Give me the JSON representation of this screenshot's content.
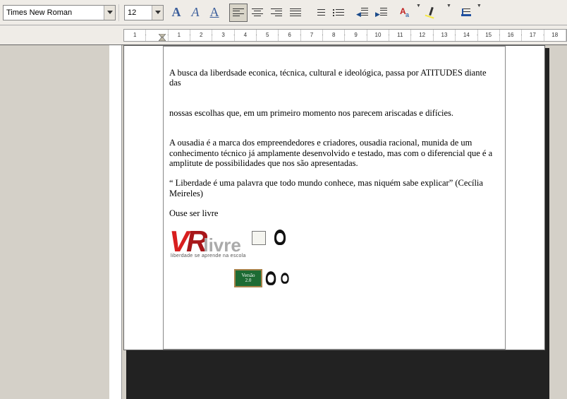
{
  "toolbar": {
    "font_name": "Times New Roman",
    "font_size": "12"
  },
  "ruler": {
    "marks": [
      "1",
      "",
      "1",
      "2",
      "3",
      "4",
      "5",
      "6",
      "7",
      "8",
      "9",
      "10",
      "11",
      "12",
      "13",
      "14",
      "15",
      "16",
      "17",
      "18"
    ]
  },
  "document": {
    "p1": "A busca da liberdsade econica, técnica, cultural e ideológica, passa por ATITUDES diante das",
    "p2": "nossas escolhas que, em um primeiro momento nos parecem ariscadas e difícies.",
    "p3": "A ousadia é a marca dos empreendedores e criadores, ousadia racional, munida de um conhecimento técnico já amplamente desenvolvido e testado, mas com o diferencial que é a amplitute de possibilidades que nos são apresentadas.",
    "p4": "“ Liberdade é uma palavra  que todo mundo conhece, mas niquém sabe explicar” (Cecília Meireles)",
    "p5": "Ouse ser livre"
  },
  "logo": {
    "v": "V",
    "r": "R",
    "livre": "livre",
    "tagline": "liberdade se aprende na escola",
    "version_label": "Versão",
    "version_num": "2.0"
  }
}
